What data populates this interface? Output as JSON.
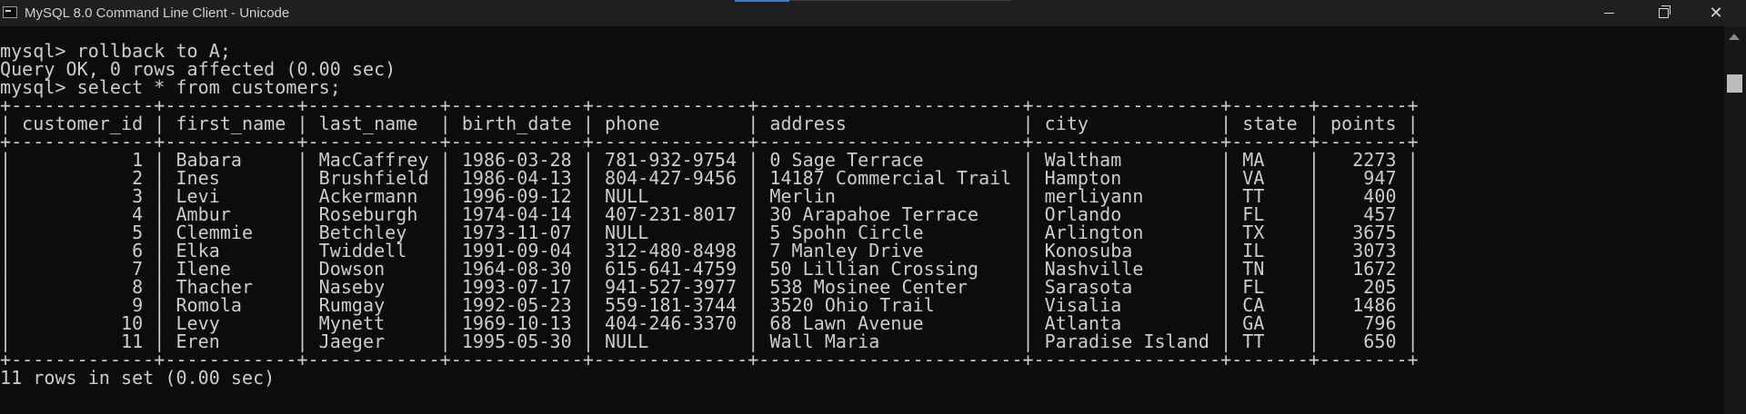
{
  "window": {
    "title": "MySQL 8.0 Command Line Client - Unicode",
    "icon": "mysql-console-icon",
    "controls": {
      "minimize": "minimize-icon",
      "maximize": "maximize-icon",
      "close": "✕"
    }
  },
  "console": {
    "lines": [
      "",
      "mysql> rollback to A;",
      "Query OK, 0 rows affected (0.00 sec)",
      "",
      "mysql> select * from customers;",
      "+-------------+------------+------------+------------+--------------+------------------------+-----------------+-------+--------+",
      "| customer_id | first_name | last_name  | birth_date | phone        | address                | city            | state | points |",
      "+-------------+------------+------------+------------+--------------+------------------------+-----------------+-------+--------+",
      "|           1 | Babara     | MacCaffrey | 1986-03-28 | 781-932-9754 | 0 Sage Terrace         | Waltham         | MA    |   2273 |",
      "|           2 | Ines       | Brushfield | 1986-04-13 | 804-427-9456 | 14187 Commercial Trail | Hampton         | VA    |    947 |",
      "|           3 | Levi       | Ackermann  | 1996-09-12 | NULL         | Merlin                 | merliyann       | TT    |    400 |",
      "|           4 | Ambur      | Roseburgh  | 1974-04-14 | 407-231-8017 | 30 Arapahoe Terrace    | Orlando         | FL    |    457 |",
      "|           5 | Clemmie    | Betchley   | 1973-11-07 | NULL         | 5 Spohn Circle         | Arlington       | TX    |   3675 |",
      "|           6 | Elka       | Twiddell   | 1991-09-04 | 312-480-8498 | 7 Manley Drive         | Konosuba        | IL    |   3073 |",
      "|           7 | Ilene      | Dowson     | 1964-08-30 | 615-641-4759 | 50 Lillian Crossing    | Nashville       | TN    |   1672 |",
      "|           8 | Thacher    | Naseby     | 1993-07-17 | 941-527-3977 | 538 Mosinee Center     | Sarasota        | FL    |    205 |",
      "|           9 | Romola     | Rumgay     | 1992-05-23 | 559-181-3744 | 3520 Ohio Trail        | Visalia         | CA    |   1486 |",
      "|          10 | Levy       | Mynett     | 1969-10-13 | 404-246-3370 | 68 Lawn Avenue         | Atlanta         | GA    |    796 |",
      "|          11 | Eren       | Jaeger     | 1995-05-30 | NULL         | Wall Maria             | Paradise Island | TT    |    650 |",
      "+-------------+------------+------------+------------+--------------+------------------------+-----------------+-------+--------+",
      "11 rows in set (0.00 sec)"
    ]
  },
  "scrollbar": {
    "up_icon": "scroll-up-arrow-icon"
  },
  "colors": {
    "background": "#0c0c0c",
    "text": "#cccccc",
    "titlebar": "#1f1f1f"
  }
}
